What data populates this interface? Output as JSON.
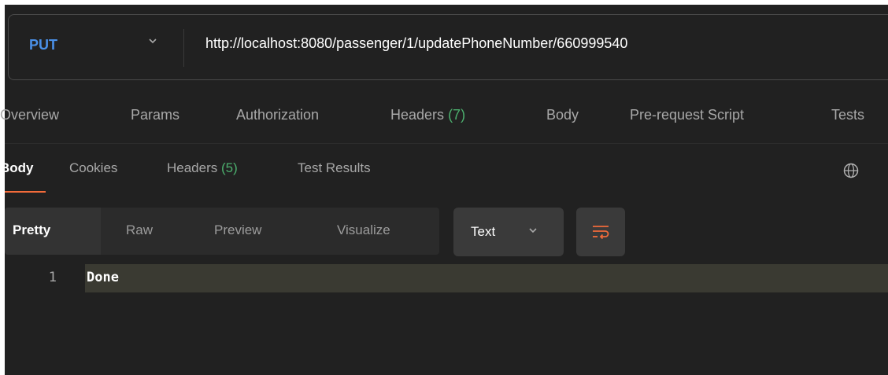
{
  "request": {
    "method": "PUT",
    "url": "http://localhost:8080/passenger/1/updatePhoneNumber/660999540"
  },
  "request_tabs": {
    "overview": "Overview",
    "params": "Params",
    "authorization": "Authorization",
    "headers_label": "Headers",
    "headers_count": "(7)",
    "body": "Body",
    "prerequest": "Pre-request Script",
    "tests": "Tests"
  },
  "response_tabs": {
    "body": "Body",
    "cookies": "Cookies",
    "headers_label": "Headers",
    "headers_count": "(5)",
    "test_results": "Test Results"
  },
  "format": {
    "pretty": "Pretty",
    "raw": "Raw",
    "preview": "Preview",
    "visualize": "Visualize",
    "type": "Text"
  },
  "editor": {
    "line_number": "1",
    "content": "Done"
  },
  "colors": {
    "method": "#4a90e8",
    "count": "#4caf6e",
    "active_tab_underline": "#f26b3a",
    "wrap_icon": "#f26b3a"
  },
  "icons": {
    "method_dropdown": "chevron-down-icon",
    "globe": "globe-icon",
    "type_dropdown": "chevron-down-icon",
    "wrap": "wrap-lines-icon"
  }
}
